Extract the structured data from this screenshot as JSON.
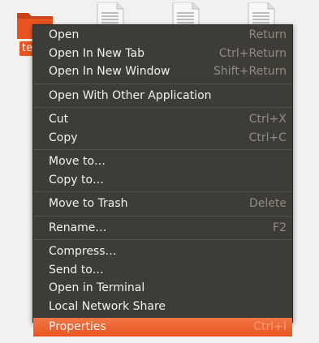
{
  "desktop": {
    "folder_label": "te"
  },
  "menu": {
    "groups": [
      [
        {
          "label": "Open",
          "accel": "Return"
        },
        {
          "label": "Open In New Tab",
          "accel": "Ctrl+Return"
        },
        {
          "label": "Open In New Window",
          "accel": "Shift+Return"
        }
      ],
      [
        {
          "label": "Open With Other Application",
          "accel": ""
        }
      ],
      [
        {
          "label": "Cut",
          "accel": "Ctrl+X"
        },
        {
          "label": "Copy",
          "accel": "Ctrl+C"
        }
      ],
      [
        {
          "label": "Move to…",
          "accel": ""
        },
        {
          "label": "Copy to…",
          "accel": ""
        }
      ],
      [
        {
          "label": "Move to Trash",
          "accel": "Delete"
        }
      ],
      [
        {
          "label": "Rename…",
          "accel": "F2"
        }
      ],
      [
        {
          "label": "Compress…",
          "accel": ""
        },
        {
          "label": "Send to…",
          "accel": ""
        },
        {
          "label": "Open in Terminal",
          "accel": ""
        },
        {
          "label": "Local Network Share",
          "accel": ""
        }
      ],
      [
        {
          "label": "Properties",
          "accel": "Ctrl+I",
          "selected": true
        }
      ]
    ]
  },
  "colors": {
    "menu_bg": "#3d3c37",
    "accent": "#e95420",
    "text": "#f2f1f0",
    "accel_text": "#8e8c85"
  }
}
